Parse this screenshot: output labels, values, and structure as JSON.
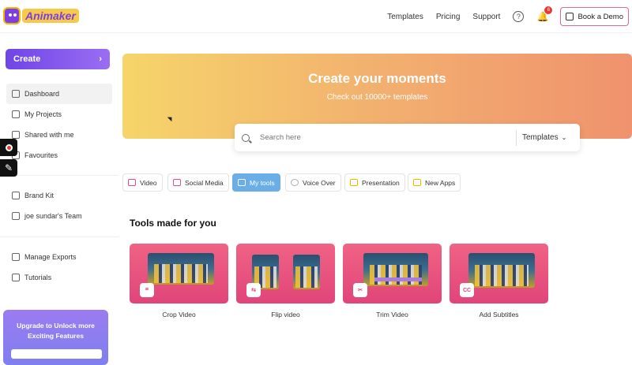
{
  "brand": {
    "name": "Animaker"
  },
  "header": {
    "nav": [
      "Templates",
      "Pricing",
      "Support"
    ],
    "help_icon": "?",
    "notification_count": "6",
    "demo_label": "Book a Demo"
  },
  "sidebar": {
    "create_label": "Create",
    "items": [
      {
        "label": "Dashboard",
        "icon": "grid-icon"
      },
      {
        "label": "My Projects",
        "icon": "file-icon"
      },
      {
        "label": "Shared with me",
        "icon": "share-icon"
      },
      {
        "label": "Favourites",
        "icon": "star-icon"
      },
      {
        "label": "Brand Kit",
        "icon": "brand-icon"
      },
      {
        "label": "joe sundar's Team",
        "icon": "team-icon"
      },
      {
        "label": "Manage Exports",
        "icon": "export-icon"
      },
      {
        "label": "Tutorials",
        "icon": "tutorial-icon"
      }
    ],
    "upgrade_text": "Upgrade to Unlock more Exciting Features"
  },
  "hero": {
    "title": "Create your moments",
    "subtitle": "Check out 10000+ templates",
    "search_placeholder": "Search here",
    "search_category": "Templates"
  },
  "tabs": [
    {
      "label": "Video"
    },
    {
      "label": "Social Media"
    },
    {
      "label": "My tools",
      "active": true
    },
    {
      "label": "Voice Over"
    },
    {
      "label": "Presentation"
    },
    {
      "label": "New Apps"
    }
  ],
  "tools": {
    "title": "Tools made for you",
    "cards": [
      {
        "label": "Crop Video",
        "badge": "⌗"
      },
      {
        "label": "Flip video",
        "badge": "⇆"
      },
      {
        "label": "Trim Video",
        "badge": "✂"
      },
      {
        "label": "Add Subtitles",
        "badge": "CC"
      }
    ]
  }
}
